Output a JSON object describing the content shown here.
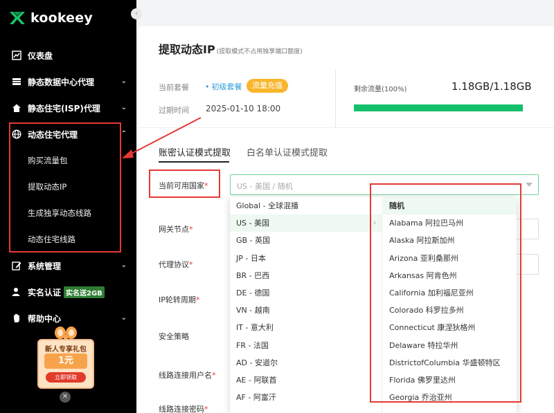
{
  "brand": {
    "name": "kookeey"
  },
  "sidebar": {
    "items": [
      {
        "label": "仪表盘",
        "icon": "chart-icon"
      },
      {
        "label": "静态数据中心代理",
        "icon": "server-icon"
      },
      {
        "label": "静态住宅(ISP)代理",
        "icon": "home-icon"
      },
      {
        "label": "动态住宅代理",
        "icon": "globe-icon"
      },
      {
        "label": "系统管理",
        "icon": "edit-icon"
      },
      {
        "label": "实名认证",
        "icon": "user-icon",
        "badge": "实名送2GB"
      },
      {
        "label": "帮助中心",
        "icon": "hand-icon"
      }
    ],
    "sub_items": [
      "购买流量包",
      "提取动态IP",
      "生成独享动态线路",
      "动态住宅线路"
    ],
    "gift": {
      "title": "新人专享礼包",
      "price": "1元",
      "cta": "立即领取"
    }
  },
  "header": {
    "title": "提取动态IP",
    "subtitle": "(提取模式不占用独享端口额度)"
  },
  "plan": {
    "plan_label": "当前套餐",
    "plan_value": "初级套餐",
    "recharge_label": "流量充值",
    "expire_label": "过期时间",
    "expire_value": "2025-01-10 18:00",
    "traffic_label": "剩余流量(100%)",
    "traffic_value": "1.18GB/1.18GB",
    "traffic_percent": 100
  },
  "tabs": [
    {
      "label": "账密认证模式提取",
      "active": true
    },
    {
      "label": "白名单认证模式提取",
      "active": false
    }
  ],
  "form": {
    "country_label": "当前可用国家",
    "country_value": "US - 美国 / 随机",
    "gateway_label": "网关节点",
    "protocol_label": "代理协议",
    "rotation_label": "IP轮转周期",
    "security_label": "安全策略",
    "username_label": "线路连接用户名",
    "password_label": "线路连接密码"
  },
  "dropdown": {
    "countries": [
      "Global - 全球混播",
      "US - 美国",
      "GB - 英国",
      "JP - 日本",
      "BR - 巴西",
      "DE - 德国",
      "VN - 越南",
      "IT - 意大利",
      "FR - 法国",
      "AD - 安道尔",
      "AE - 阿联酋",
      "AF - 阿富汗"
    ],
    "regions": [
      "随机",
      "Alabama 阿拉巴马州",
      "Alaska 阿拉斯加州",
      "Arizona 亚利桑那州",
      "Arkansas 阿肯色州",
      "California 加利福尼亚州",
      "Colorado 科罗拉多州",
      "Connecticut 康涅狄格州",
      "Delaware 特拉华州",
      "DistrictofColumbia 华盛顿特区",
      "Florida 佛罗里达州",
      "Georgia 乔治亚州"
    ]
  },
  "colors": {
    "accent_green": "#14c06b",
    "highlight_red": "#e53935",
    "recharge_orange": "#f8b62d",
    "plan_blue": "#2d9cdb"
  }
}
